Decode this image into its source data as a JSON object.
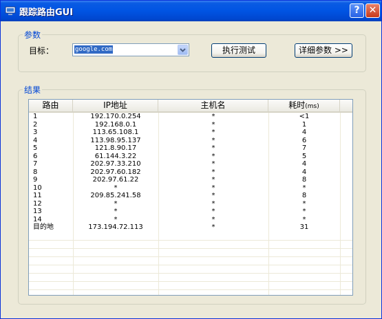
{
  "window": {
    "title": "跟踪路由GUI",
    "help_glyph": "?",
    "close_glyph": "✕"
  },
  "params": {
    "legend": "参数",
    "target_label": "目标：",
    "target_value": "google.com",
    "run_label": "执行测试",
    "details_label": "详细参数 >>"
  },
  "results": {
    "legend": "结果",
    "columns": {
      "hop": "路由",
      "ip": "IP地址",
      "host": "主机名",
      "time": "耗时",
      "time_unit": "(ms)"
    },
    "rows": [
      {
        "hop": "1",
        "ip": "192.170.0.254",
        "host": "*",
        "time": "<1"
      },
      {
        "hop": "2",
        "ip": "192.168.0.1",
        "host": "*",
        "time": "1"
      },
      {
        "hop": "3",
        "ip": "113.65.108.1",
        "host": "*",
        "time": "4"
      },
      {
        "hop": "4",
        "ip": "113.98.95.137",
        "host": "*",
        "time": "6"
      },
      {
        "hop": "5",
        "ip": "121.8.90.17",
        "host": "*",
        "time": "7"
      },
      {
        "hop": "6",
        "ip": "61.144.3.22",
        "host": "*",
        "time": "5"
      },
      {
        "hop": "7",
        "ip": "202.97.33.210",
        "host": "*",
        "time": "4"
      },
      {
        "hop": "8",
        "ip": "202.97.60.182",
        "host": "*",
        "time": "4"
      },
      {
        "hop": "9",
        "ip": "202.97.61.22",
        "host": "*",
        "time": "8"
      },
      {
        "hop": "10",
        "ip": "*",
        "host": "*",
        "time": "*"
      },
      {
        "hop": "11",
        "ip": "209.85.241.58",
        "host": "*",
        "time": "8"
      },
      {
        "hop": "12",
        "ip": "*",
        "host": "*",
        "time": "*"
      },
      {
        "hop": "13",
        "ip": "*",
        "host": "*",
        "time": "*"
      },
      {
        "hop": "14",
        "ip": "*",
        "host": "*",
        "time": "*"
      },
      {
        "hop": "目的地",
        "ip": "173.194.72.113",
        "host": "*",
        "time": "31"
      }
    ]
  }
}
